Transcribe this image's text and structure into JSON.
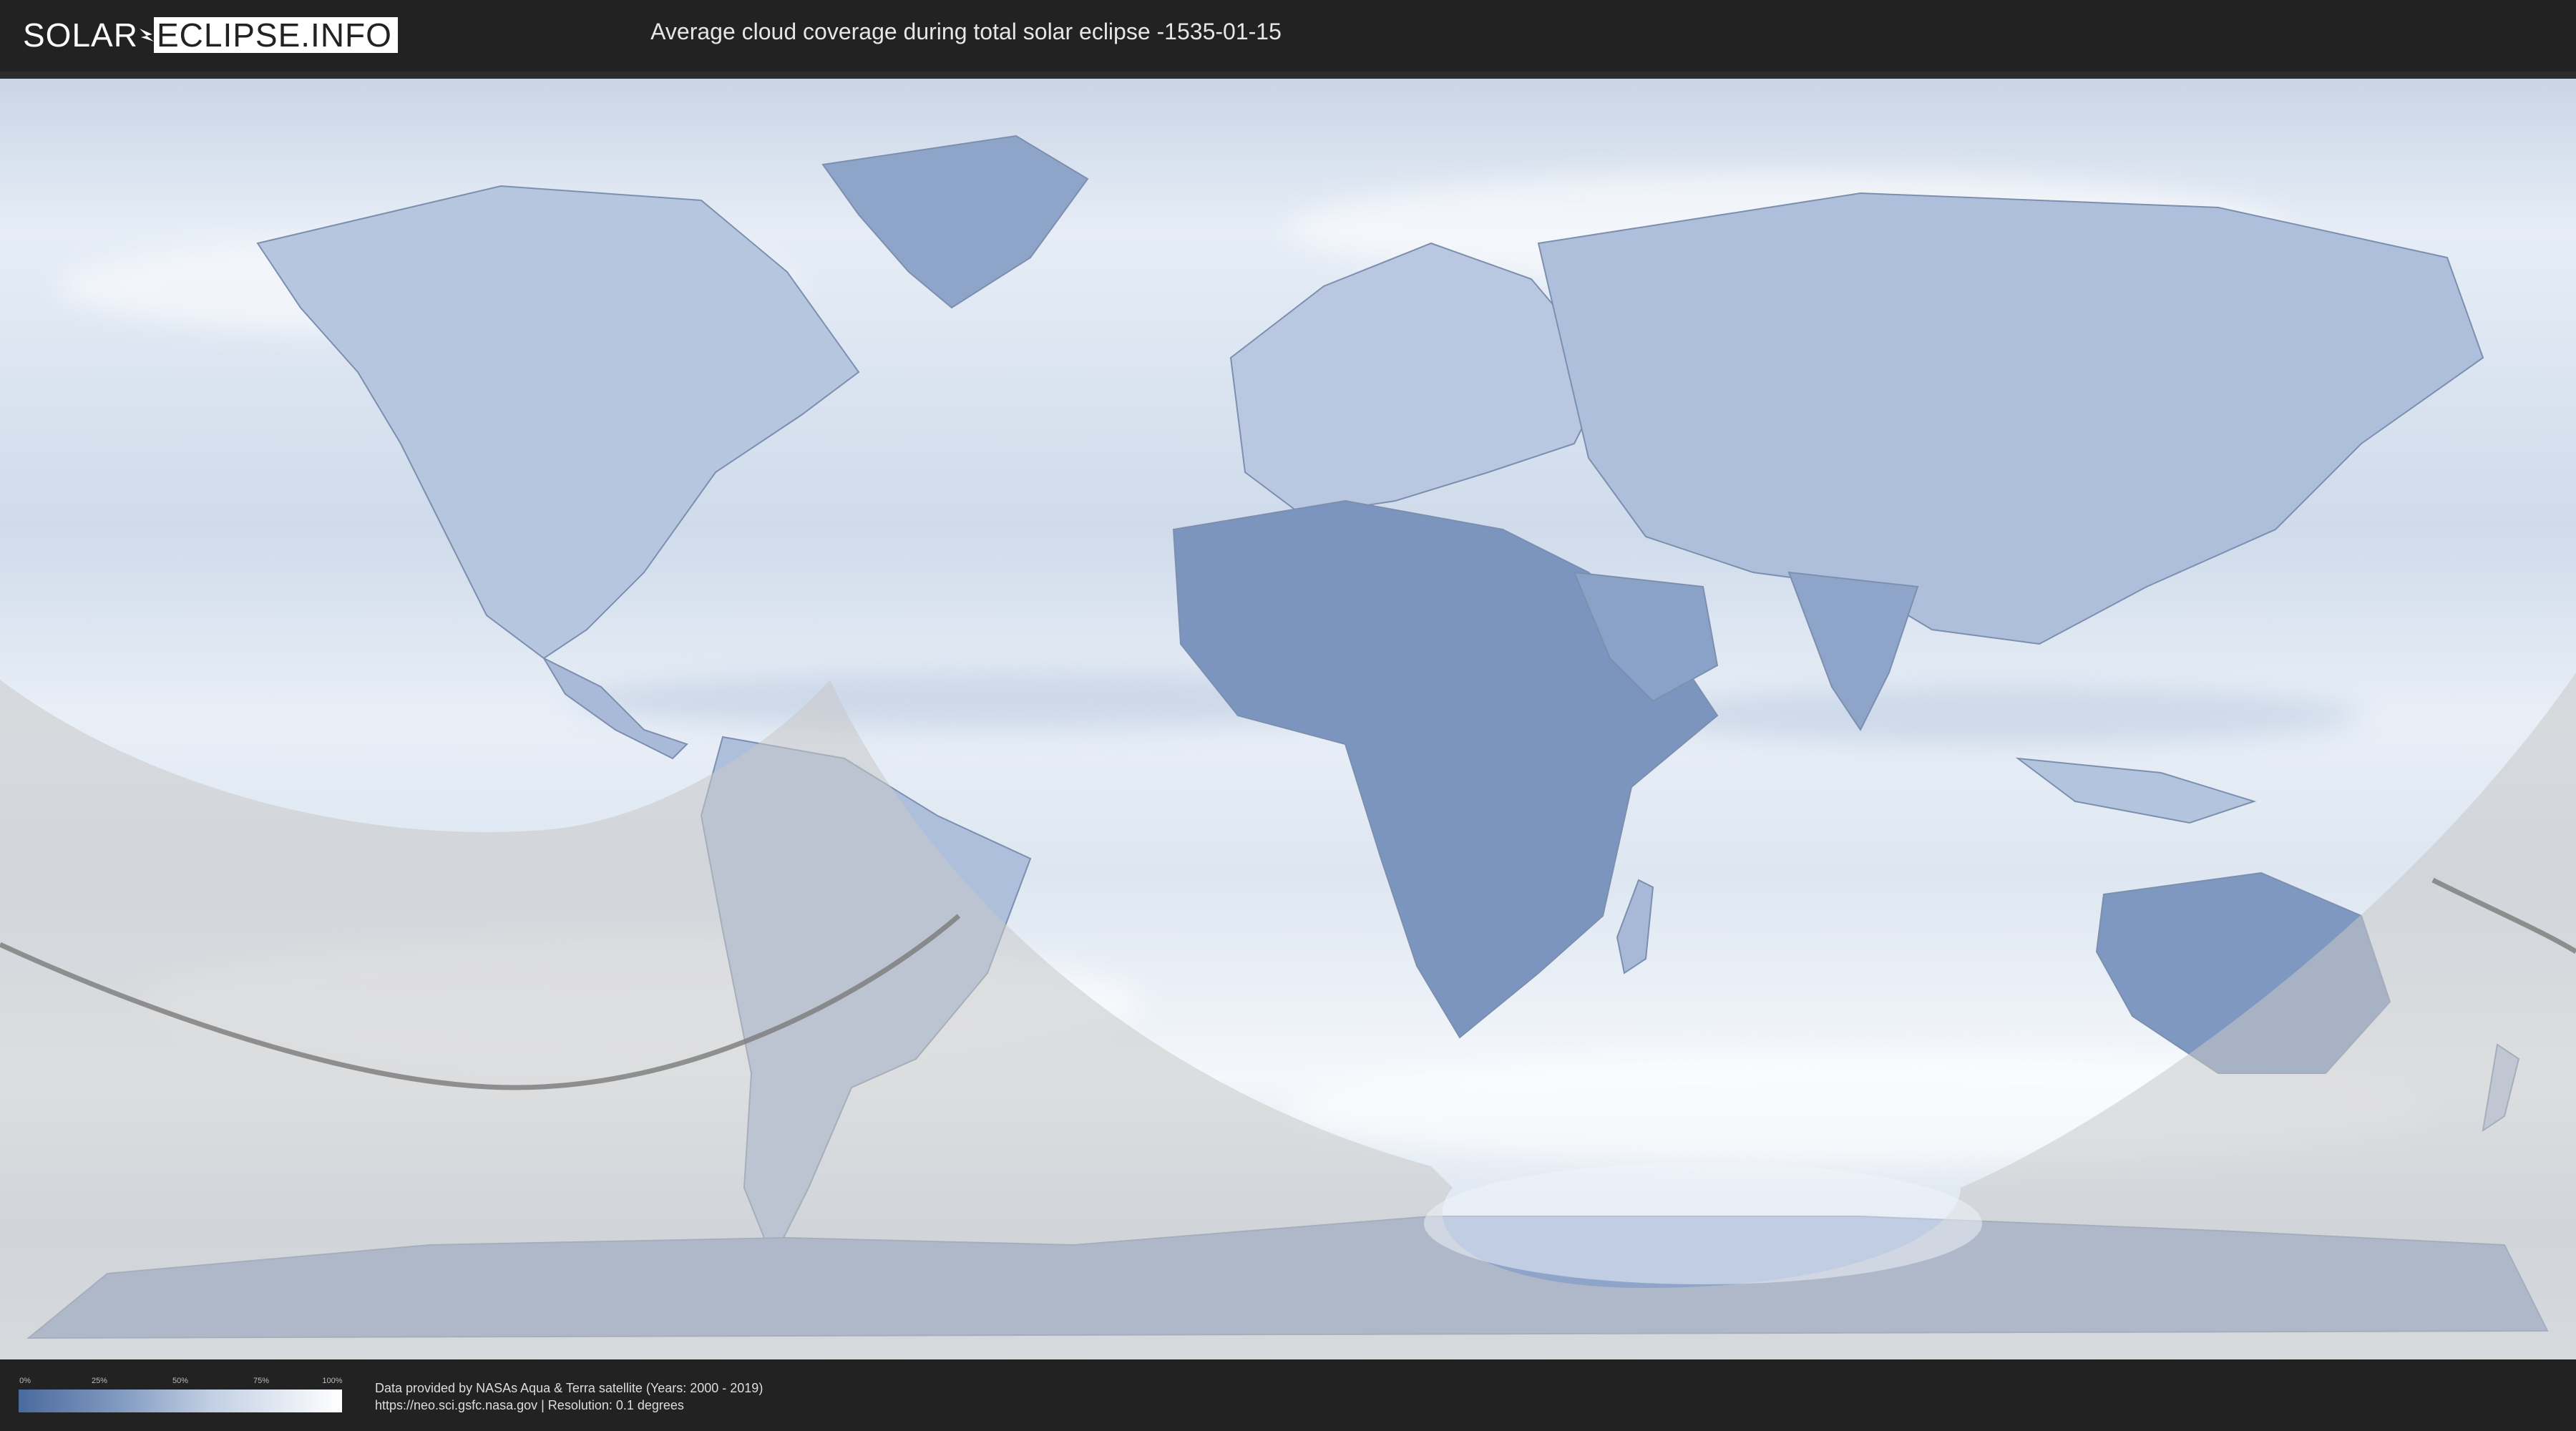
{
  "header": {
    "logo_part1": "SOLAR",
    "logo_part2": "ECLIPSE.INFO",
    "title": "Average cloud coverage during total solar eclipse -1535-01-15"
  },
  "map": {
    "description_icon": "world-map-cloud-coverage",
    "colors": {
      "ocean_cloud": "#dfe7f2",
      "clear_land": "#6d87b4",
      "heavy_cloud": "#ffffff",
      "night_overlay": "#c8c8c8",
      "eclipse_path": "#7a7a7a"
    }
  },
  "legend": {
    "ticks": [
      "0%",
      "25%",
      "50%",
      "75%",
      "100%"
    ],
    "colors": {
      "start": "#4a6a9e",
      "end": "#ffffff"
    }
  },
  "credits": {
    "line1": "Data provided by NASAs Aqua & Terra satellite (Years: 2000 - 2019)",
    "line2": "https://neo.sci.gsfc.nasa.gov | Resolution: 0.1 degrees"
  }
}
